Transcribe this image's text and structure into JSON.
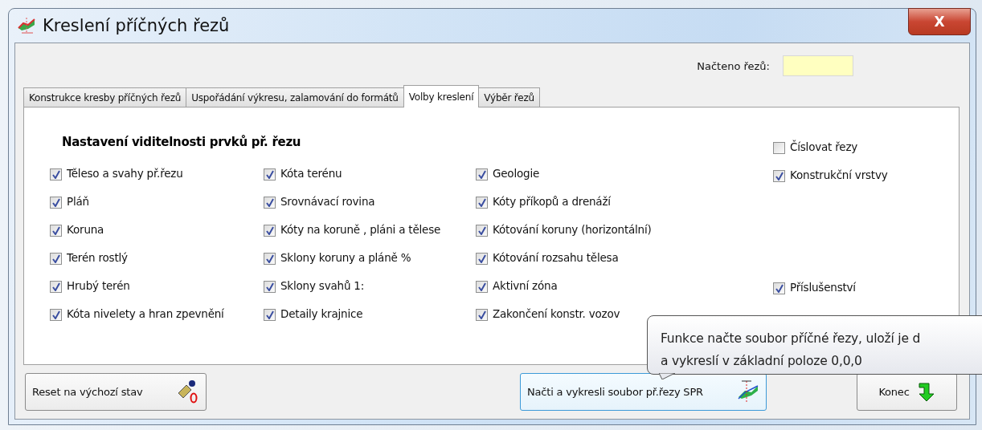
{
  "window": {
    "title": "Kreslení příčných řezů",
    "close_label": "X"
  },
  "loaded_count": {
    "label": "Načteno řezů:"
  },
  "tabs": [
    {
      "label": "Konstrukce kresby příčných řezů",
      "selected": false
    },
    {
      "label": "Uspořádání výkresu, zalamování do formátů",
      "selected": false
    },
    {
      "label": "Volby kreslení",
      "selected": true
    },
    {
      "label": "Výběr řezů",
      "selected": false
    }
  ],
  "panel": {
    "heading": "Nastavení viditelnosti prvků př. řezu",
    "columns": [
      [
        {
          "label": "Těleso a svahy př.řezu",
          "checked": true
        },
        {
          "label": "Pláň",
          "checked": true
        },
        {
          "label": "Koruna",
          "checked": true
        },
        {
          "label": "Terén rostlý",
          "checked": true
        },
        {
          "label": "Hrubý terén",
          "checked": true
        },
        {
          "label": "Kóta nivelety a hran zpevnění",
          "checked": true
        }
      ],
      [
        {
          "label": "Kóta terénu",
          "checked": true
        },
        {
          "label": "Srovnávací rovina",
          "checked": true
        },
        {
          "label": "Kóty na koruně , pláni a tělese",
          "checked": true
        },
        {
          "label": "Sklony koruny a pláně %",
          "checked": true
        },
        {
          "label": "Sklony svahů 1:",
          "checked": true
        },
        {
          "label": "Detaily krajnice",
          "checked": true
        }
      ],
      [
        {
          "label": "Geologie",
          "checked": true
        },
        {
          "label": "Kóty příkopů a drenáží",
          "checked": true
        },
        {
          "label": "Kótování koruny (horizontální)",
          "checked": true
        },
        {
          "label": "Kótování rozsahu tělesa",
          "checked": true
        },
        {
          "label": "Aktivní zóna",
          "checked": true
        },
        {
          "label": "Zakončení konstr. vozov",
          "checked": true
        }
      ]
    ],
    "side_groups": [
      [
        {
          "label": "Číslovat řezy",
          "checked": false
        },
        {
          "label": "Konstrukční vrstvy",
          "checked": true
        }
      ],
      [
        {
          "label": "Příslušenství",
          "checked": true
        }
      ]
    ]
  },
  "buttons": [
    {
      "kind": "reset",
      "label": "Reset na výchozí stav"
    },
    {
      "kind": "load",
      "label": "Načti a vykresli soubor př.řezy SPR"
    },
    {
      "kind": "exit",
      "label": "Konec"
    }
  ],
  "tooltip": {
    "lines": [
      "Funkce načte soubor příčné řezy, uloží je d",
      "a vykreslí v základní poloze 0,0,0"
    ]
  }
}
